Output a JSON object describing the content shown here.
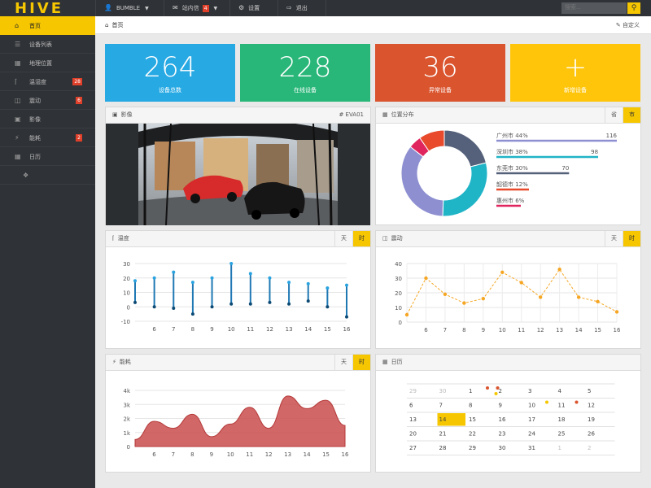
{
  "topbar": {
    "logo": "HIVE",
    "user": "BUMBLE",
    "inbox_label": "站内信",
    "inbox_count": "4",
    "settings": "设置",
    "logout": "退出",
    "search_placeholder": "搜索..."
  },
  "sidebar": {
    "items": [
      {
        "label": "首页",
        "icon": "home-icon",
        "active": true
      },
      {
        "label": "设备列表",
        "icon": "list-icon"
      },
      {
        "label": "地理位置",
        "icon": "map-icon"
      },
      {
        "label": "温湿度",
        "icon": "thermometer-icon",
        "badge": "28"
      },
      {
        "label": "震动",
        "icon": "vibration-icon",
        "badge": "6"
      },
      {
        "label": "影像",
        "icon": "camera-icon"
      },
      {
        "label": "能耗",
        "icon": "plug-icon",
        "badge": "2"
      },
      {
        "label": "日历",
        "icon": "calendar-icon"
      },
      {
        "label": "",
        "icon": "tag-icon"
      }
    ]
  },
  "breadcrumb": {
    "home": "首页",
    "customize": "自定义"
  },
  "tiles": [
    {
      "value": "264",
      "label": "设备总数",
      "color": "#27a9e3"
    },
    {
      "value": "228",
      "label": "在线设备",
      "color": "#28b779"
    },
    {
      "value": "36",
      "label": "异常设备",
      "color": "#da542e"
    },
    {
      "value": "+",
      "label": "新增设备",
      "color": "#ffc50b"
    }
  ],
  "panels": {
    "image": {
      "title": "影像",
      "tag": "# EVA01"
    },
    "location": {
      "title": "位置分布",
      "tab1": "省",
      "tab2": "市"
    },
    "temperature": {
      "title": "温度",
      "tab1": "天",
      "tab2": "时"
    },
    "vibration": {
      "title": "震动",
      "tab1": "天",
      "tab2": "时"
    },
    "energy": {
      "title": "能耗",
      "tab1": "天",
      "tab2": "时"
    },
    "calendar": {
      "title": "日历"
    }
  },
  "chart_data": [
    {
      "type": "pie",
      "labels": [
        "广州市",
        "深圳市",
        "东莞市",
        "惠州市",
        "韶德市"
      ],
      "legend": [
        {
          "name": "广州市 44%",
          "value": 116,
          "color": "#8e8fd1"
        },
        {
          "name": "深圳市 38%",
          "value": 98,
          "color": "#20b4c7"
        },
        {
          "name": "东莞市 30%",
          "value": 70,
          "color": "#55617a"
        },
        {
          "name": "韶德市 12%",
          "value": null,
          "color": "#e84a2b"
        },
        {
          "name": "惠州市 6%",
          "value": null,
          "color": "#e0245e"
        }
      ],
      "slices": [
        {
          "name": "东莞市",
          "value": 70,
          "color": "#55617a"
        },
        {
          "name": "深圳市",
          "value": 98,
          "color": "#20b4c7"
        },
        {
          "name": "广州市",
          "value": 116,
          "color": "#8e8fd1"
        },
        {
          "name": "惠州市",
          "value": 16,
          "color": "#e0245e"
        },
        {
          "name": "韶德市",
          "value": 32,
          "color": "#e84a2b"
        }
      ]
    },
    {
      "type": "range",
      "x": [
        5,
        6,
        7,
        8,
        9,
        10,
        11,
        12,
        13,
        14,
        15,
        16
      ],
      "high": [
        18,
        20,
        24,
        17,
        20,
        30,
        23,
        20,
        17,
        16,
        13,
        15
      ],
      "low": [
        3,
        0,
        -1,
        -5,
        0,
        2,
        2,
        3,
        2,
        4,
        0,
        -7
      ],
      "ylim": [
        -10,
        30
      ],
      "yticks": [
        -10,
        0,
        10,
        20,
        30
      ],
      "color": "#1f78b4"
    },
    {
      "type": "line",
      "x": [
        5,
        6,
        7,
        8,
        9,
        10,
        11,
        12,
        13,
        14,
        15,
        16
      ],
      "values": [
        5,
        30,
        19,
        13,
        16,
        34,
        27,
        17,
        36,
        17,
        14,
        7
      ],
      "ylim": [
        0,
        40
      ],
      "yticks": [
        0,
        10,
        20,
        30,
        40
      ],
      "color": "#f5a623"
    },
    {
      "type": "area",
      "x": [
        5,
        6,
        7,
        8,
        9,
        10,
        11,
        12,
        13,
        14,
        15,
        16
      ],
      "values": [
        500,
        1800,
        1300,
        2300,
        700,
        1600,
        2800,
        1300,
        3600,
        2700,
        3300,
        1500
      ],
      "ylim": [
        0,
        4000
      ],
      "yticks": [
        "0",
        "1k",
        "2k",
        "3k",
        "4k"
      ],
      "color": "#c94c4c"
    }
  ],
  "calendar": {
    "weeks": [
      [
        "29",
        "30",
        "1",
        "2",
        "3",
        "4",
        "5"
      ],
      [
        "6",
        "7",
        "8",
        "9",
        "10",
        "11",
        "12"
      ],
      [
        "13",
        "14",
        "15",
        "16",
        "17",
        "18",
        "19"
      ],
      [
        "20",
        "21",
        "22",
        "23",
        "24",
        "25",
        "26"
      ],
      [
        "27",
        "28",
        "29",
        "30",
        "31",
        "1",
        "2"
      ]
    ],
    "today": "14"
  }
}
